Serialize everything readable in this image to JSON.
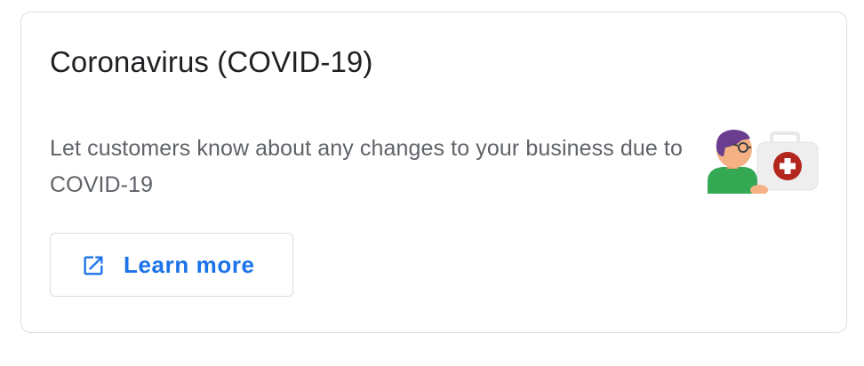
{
  "card": {
    "title": "Coronavirus (COVID-19)",
    "description": "Let customers know about any changes to your business due to COVID-19",
    "illustration": "doctor-with-first-aid-kit-icon",
    "learn_more": {
      "label": "Learn more",
      "icon": "open-in-new-icon"
    }
  },
  "colors": {
    "title": "#202124",
    "description": "#5f6368",
    "link": "#1a73e8",
    "border": "#dadce0",
    "kit_cross": "#b3261e",
    "shirt": "#34a853"
  }
}
